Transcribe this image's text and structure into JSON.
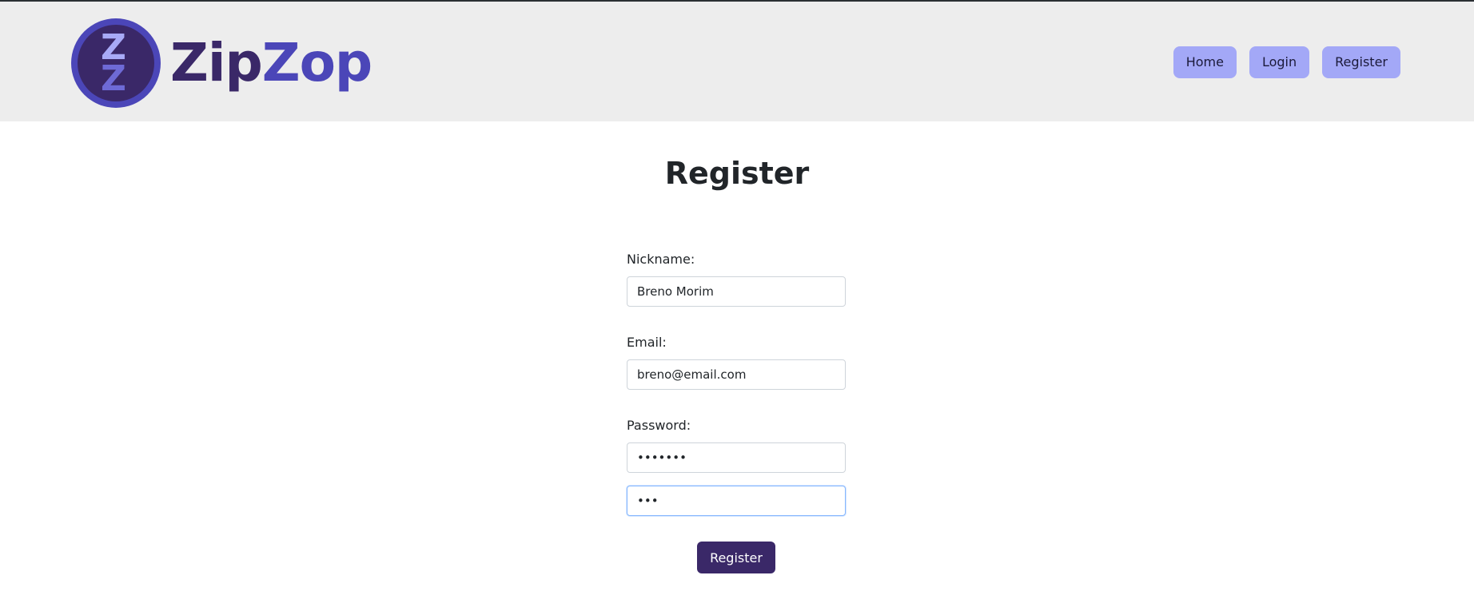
{
  "header": {
    "logo_letters": [
      "Z",
      "Z"
    ],
    "brand_part1": "Zip",
    "brand_part2": "Zop",
    "nav": [
      {
        "label": "Home"
      },
      {
        "label": "Login"
      },
      {
        "label": "Register"
      }
    ]
  },
  "main": {
    "title": "Register",
    "fields": {
      "nickname": {
        "label": "Nickname:",
        "value": "Breno Morim"
      },
      "email": {
        "label": "Email:",
        "value": "breno@email.com"
      },
      "password": {
        "label": "Password:",
        "value": "•••••••"
      },
      "confirm_password": {
        "value": "•••"
      }
    },
    "submit_label": "Register"
  },
  "colors": {
    "header_bg": "#ededed",
    "nav_button": "#a3a8f7",
    "brand_dark": "#3a2868",
    "brand_blue": "#4b46b8",
    "submit_bg": "#3a2868"
  }
}
